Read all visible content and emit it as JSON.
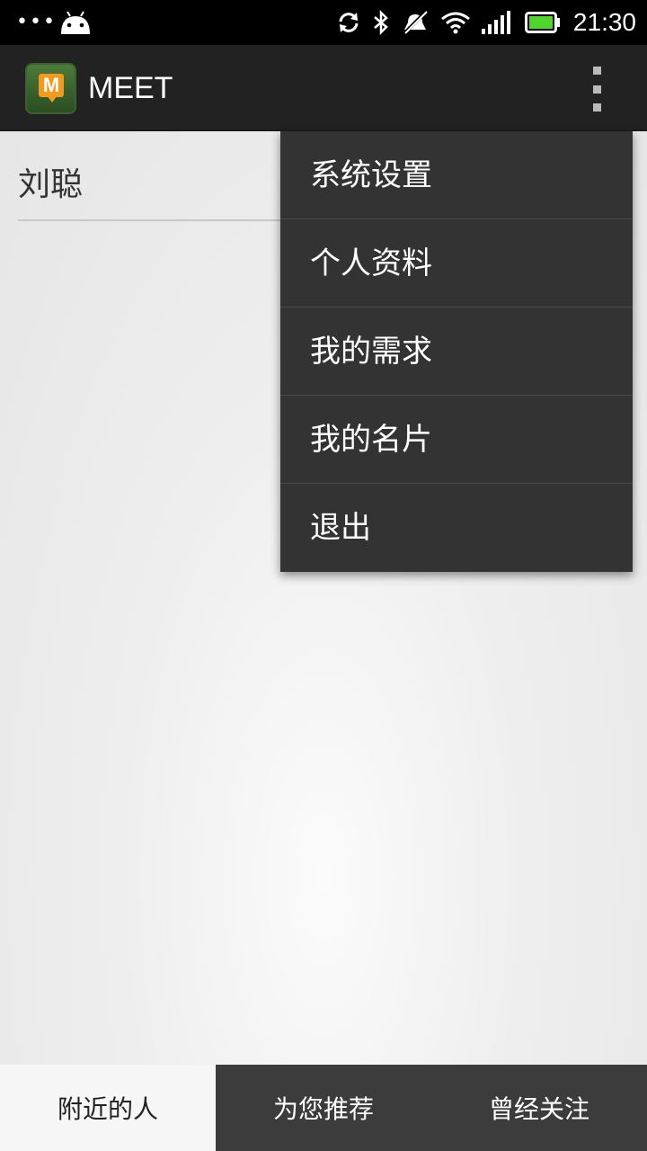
{
  "status_bar": {
    "time": "21:30",
    "icons": [
      "more-dots-icon",
      "android-icon",
      "sync-icon",
      "bluetooth-icon",
      "mute-icon",
      "wifi-icon",
      "signal-icon",
      "battery-icon"
    ]
  },
  "action_bar": {
    "logo_letter": "M",
    "title": "MEET"
  },
  "content": {
    "users": [
      {
        "name": "刘聪"
      }
    ]
  },
  "menu": {
    "items": [
      {
        "label": "系统设置"
      },
      {
        "label": "个人资料"
      },
      {
        "label": "我的需求"
      },
      {
        "label": "我的名片"
      },
      {
        "label": "退出"
      }
    ]
  },
  "tabs": [
    {
      "label": "附近的人",
      "active": true
    },
    {
      "label": "为您推荐",
      "active": false
    },
    {
      "label": "曾经关注",
      "active": false
    }
  ],
  "colors": {
    "status_bar_bg": "#000000",
    "action_bar_bg": "#222222",
    "menu_bg": "#333333",
    "tab_inactive_bg": "#3c3c3c",
    "logo_orange": "#f29a1d",
    "battery_green": "#4fd52b"
  }
}
